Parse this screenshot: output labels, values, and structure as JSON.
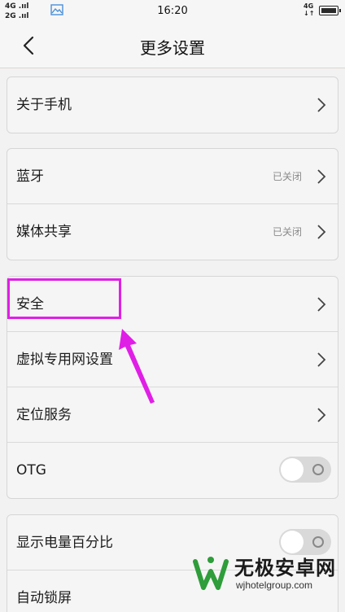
{
  "status_bar": {
    "signal_1": "4G",
    "signal_2": "2G",
    "time": "16:20",
    "network": "4G"
  },
  "header": {
    "title": "更多设置"
  },
  "groups": [
    {
      "items": [
        {
          "label": "关于手机",
          "control": "chevron"
        }
      ]
    },
    {
      "items": [
        {
          "label": "蓝牙",
          "value": "已关闭",
          "control": "chevron"
        },
        {
          "label": "媒体共享",
          "value": "已关闭",
          "control": "chevron"
        }
      ]
    },
    {
      "items": [
        {
          "label": "安全",
          "control": "chevron"
        },
        {
          "label": "虚拟专用网设置",
          "control": "chevron"
        },
        {
          "label": "定位服务",
          "control": "chevron"
        },
        {
          "label": "OTG",
          "control": "toggle",
          "on": false
        }
      ]
    },
    {
      "items": [
        {
          "label": "显示电量百分比",
          "control": "toggle",
          "on": false
        },
        {
          "label": "自动锁屏"
        }
      ]
    }
  ],
  "watermark": {
    "name": "无极安卓网",
    "url": "wjhotelgroup.com"
  },
  "colors": {
    "highlight": "#e01fe6",
    "background": "#f2f2f2"
  }
}
